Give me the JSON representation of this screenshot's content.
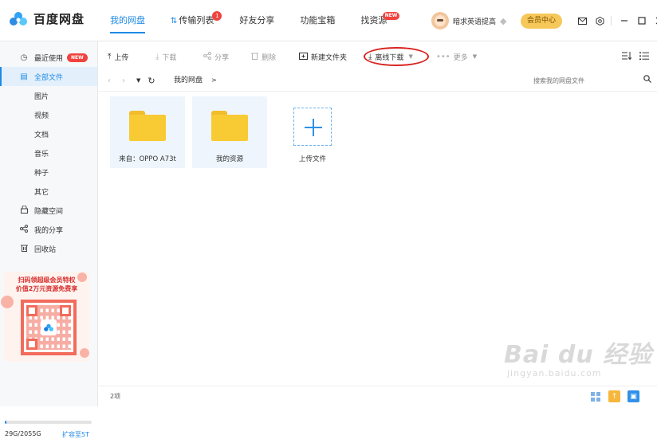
{
  "app": {
    "name": "百度网盘"
  },
  "nav": {
    "items": [
      {
        "label": "我的网盘",
        "active": true
      },
      {
        "label": "传输列表",
        "badge": "1"
      },
      {
        "label": "好友分享"
      },
      {
        "label": "功能宝箱"
      },
      {
        "label": "找资源",
        "badge": "NEW"
      }
    ]
  },
  "user": {
    "name": "暗求英语提高",
    "vip_label": "会员中心"
  },
  "header_icons": [
    "mail-icon",
    "settings-icon",
    "minimize-icon",
    "maximize-icon",
    "close-icon"
  ],
  "sidebar": {
    "items": [
      {
        "label": "最近使用",
        "icon": "clock-icon",
        "badge": "NEW"
      },
      {
        "label": "全部文件",
        "icon": "file-icon",
        "active": true
      },
      {
        "label": "图片"
      },
      {
        "label": "视频"
      },
      {
        "label": "文档"
      },
      {
        "label": "音乐"
      },
      {
        "label": "种子"
      },
      {
        "label": "其它"
      },
      {
        "label": "隐藏空间",
        "icon": "lock-icon"
      },
      {
        "label": "我的分享",
        "icon": "share-icon"
      },
      {
        "label": "回收站",
        "icon": "trash-icon"
      }
    ],
    "promo": {
      "line1": "扫码领超级会员特权",
      "line2": "价值2万元资源免费享"
    },
    "storage": {
      "text": "29G/2055G",
      "used_fraction": 0.014,
      "expand_label": "扩容至5T"
    }
  },
  "toolbar": {
    "upload": "上传",
    "download": "下载",
    "share": "分享",
    "delete": "删除",
    "new_folder": "新建文件夹",
    "offline_download": "离线下载",
    "more": "更多"
  },
  "address": {
    "breadcrumb": "我的网盘",
    "separator": ">",
    "search_placeholder": "搜索我的网盘文件"
  },
  "files": [
    {
      "name": "来自：OPPO A73t",
      "type": "folder"
    },
    {
      "name": "我的资源",
      "type": "folder"
    }
  ],
  "upload_label": "上传文件",
  "status": {
    "count": "2项"
  },
  "watermark": {
    "main": "Bai du 经验",
    "sub": "jingyan.baidu.com"
  },
  "colors": {
    "accent": "#1f8ae5",
    "folder": "#f8cb34",
    "badge": "#f0433f",
    "vip": "#f6c859",
    "highlight": "#d9231f"
  }
}
